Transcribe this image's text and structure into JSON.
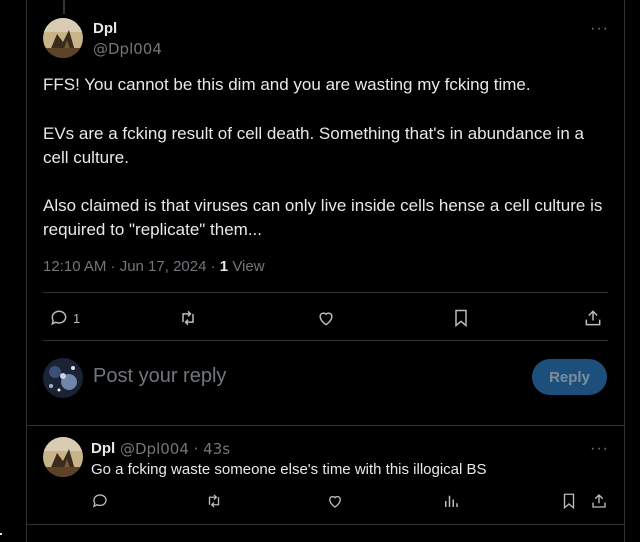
{
  "main_tweet": {
    "display_name": "Dpl",
    "handle": "@Dpl004",
    "paragraphs": [
      "FFS! You cannot be this dim and you are wasting my fcking time.",
      "EVs are a fcking result of cell death. Something that's in abundance in a cell culture.",
      "Also claimed is that viruses can only live inside cells hense a cell culture is required to \"replicate\" them..."
    ],
    "timestamp": "12:10 AM · Jun 17, 2024 ·",
    "view_count": "1",
    "view_label": "View",
    "reply_count": "1",
    "more_icon": "···"
  },
  "reply_box": {
    "placeholder": "Post your reply",
    "button_label": "Reply"
  },
  "reply_tweet": {
    "display_name": "Dpl",
    "handle": "@Dpl004 · 43s",
    "text": "Go a fcking waste someone else's time with this illogical BS",
    "more_icon": "···"
  },
  "icons": [
    "reply-icon",
    "repost-icon",
    "like-icon",
    "bookmark-icon",
    "share-icon",
    "views-icon"
  ],
  "colors": {
    "background": "#000000",
    "text": "#e7e9ea",
    "muted": "#71767b",
    "reply_button": "#1d4f7c",
    "divider": "#2f3336"
  }
}
